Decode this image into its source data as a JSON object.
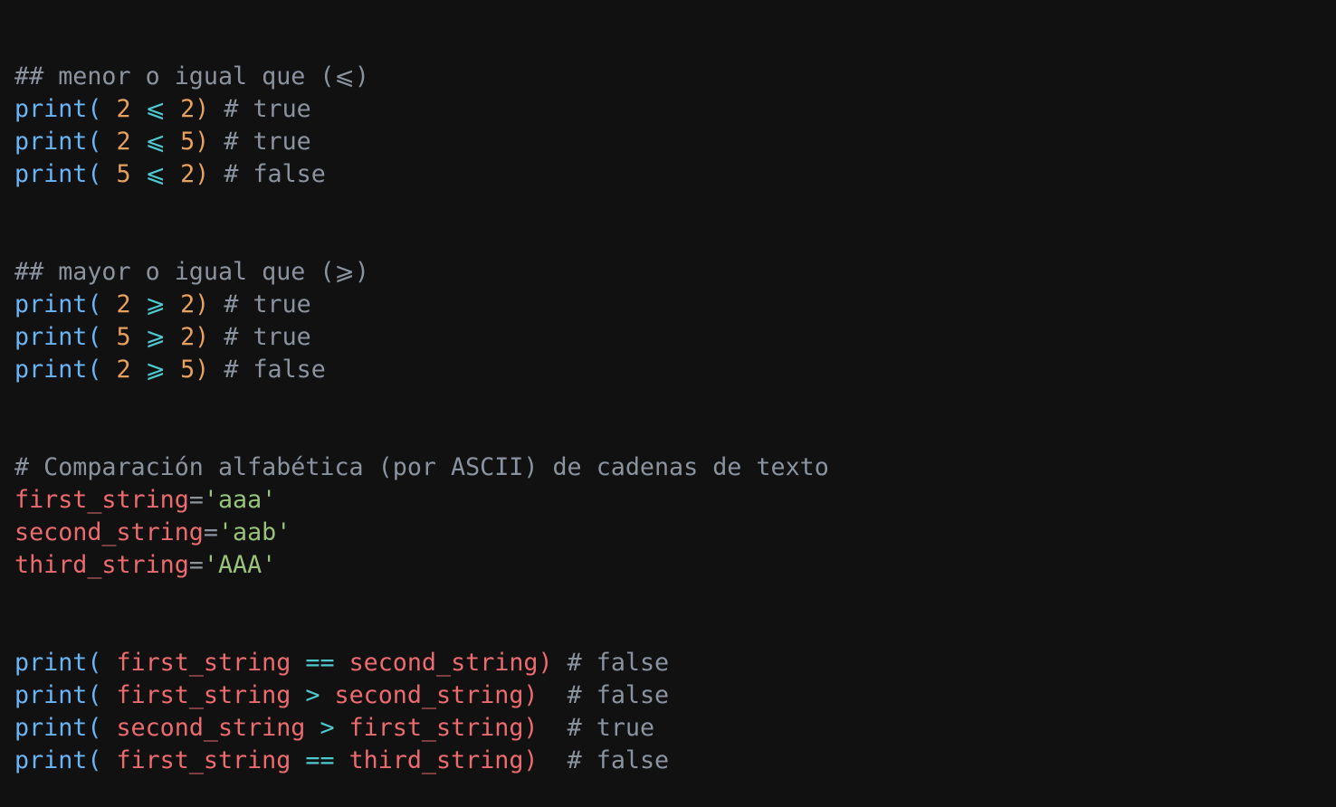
{
  "colors": {
    "background": "#111111",
    "comment": "#8b949e",
    "function": "#69b5f5",
    "paren": "#69b5f5",
    "number": "#e8a15c",
    "operator": "#4ec9cf",
    "variable": "#ec6b6f",
    "string": "#98c379",
    "plain": "#c9d1d9"
  },
  "code": {
    "lines": [
      [
        {
          "t": "## menor o igual que (⩽)",
          "k": "comment"
        }
      ],
      [
        {
          "t": "print",
          "k": "function"
        },
        {
          "t": "( ",
          "k": "paren"
        },
        {
          "t": "2",
          "k": "number"
        },
        {
          "t": " ",
          "k": "plain"
        },
        {
          "t": "⩽",
          "k": "operator"
        },
        {
          "t": " ",
          "k": "plain"
        },
        {
          "t": "2",
          "k": "number"
        },
        {
          "t": ")",
          "k": "number"
        },
        {
          "t": " # true",
          "k": "comment"
        }
      ],
      [
        {
          "t": "print",
          "k": "function"
        },
        {
          "t": "( ",
          "k": "paren"
        },
        {
          "t": "2",
          "k": "number"
        },
        {
          "t": " ",
          "k": "plain"
        },
        {
          "t": "⩽",
          "k": "operator"
        },
        {
          "t": " ",
          "k": "plain"
        },
        {
          "t": "5",
          "k": "number"
        },
        {
          "t": ")",
          "k": "number"
        },
        {
          "t": " # true",
          "k": "comment"
        }
      ],
      [
        {
          "t": "print",
          "k": "function"
        },
        {
          "t": "( ",
          "k": "paren"
        },
        {
          "t": "5",
          "k": "number"
        },
        {
          "t": " ",
          "k": "plain"
        },
        {
          "t": "⩽",
          "k": "operator"
        },
        {
          "t": " ",
          "k": "plain"
        },
        {
          "t": "2",
          "k": "number"
        },
        {
          "t": ")",
          "k": "number"
        },
        {
          "t": " # false",
          "k": "comment"
        }
      ],
      [],
      [],
      [
        {
          "t": "## mayor o igual que (⩾)",
          "k": "comment"
        }
      ],
      [
        {
          "t": "print",
          "k": "function"
        },
        {
          "t": "( ",
          "k": "paren"
        },
        {
          "t": "2",
          "k": "number"
        },
        {
          "t": " ",
          "k": "plain"
        },
        {
          "t": "⩾",
          "k": "operator"
        },
        {
          "t": " ",
          "k": "plain"
        },
        {
          "t": "2",
          "k": "number"
        },
        {
          "t": ")",
          "k": "number"
        },
        {
          "t": " # true",
          "k": "comment"
        }
      ],
      [
        {
          "t": "print",
          "k": "function"
        },
        {
          "t": "( ",
          "k": "paren"
        },
        {
          "t": "5",
          "k": "number"
        },
        {
          "t": " ",
          "k": "plain"
        },
        {
          "t": "⩾",
          "k": "operator"
        },
        {
          "t": " ",
          "k": "plain"
        },
        {
          "t": "2",
          "k": "number"
        },
        {
          "t": ")",
          "k": "number"
        },
        {
          "t": " # true",
          "k": "comment"
        }
      ],
      [
        {
          "t": "print",
          "k": "function"
        },
        {
          "t": "( ",
          "k": "paren"
        },
        {
          "t": "2",
          "k": "number"
        },
        {
          "t": " ",
          "k": "plain"
        },
        {
          "t": "⩾",
          "k": "operator"
        },
        {
          "t": " ",
          "k": "plain"
        },
        {
          "t": "5",
          "k": "number"
        },
        {
          "t": ")",
          "k": "number"
        },
        {
          "t": " # false",
          "k": "comment"
        }
      ],
      [],
      [],
      [
        {
          "t": "# Comparación alfabética (por ASCII) de cadenas de texto",
          "k": "comment"
        }
      ],
      [
        {
          "t": "first_string",
          "k": "variable"
        },
        {
          "t": "=",
          "k": "comment"
        },
        {
          "t": "'aaa'",
          "k": "string"
        }
      ],
      [
        {
          "t": "second_string",
          "k": "variable"
        },
        {
          "t": "=",
          "k": "comment"
        },
        {
          "t": "'aab'",
          "k": "string"
        }
      ],
      [
        {
          "t": "third_string",
          "k": "variable"
        },
        {
          "t": "=",
          "k": "comment"
        },
        {
          "t": "'AAA'",
          "k": "string"
        }
      ],
      [],
      [],
      [
        {
          "t": "print",
          "k": "function"
        },
        {
          "t": "( ",
          "k": "paren"
        },
        {
          "t": "first_string",
          "k": "variable"
        },
        {
          "t": " ",
          "k": "plain"
        },
        {
          "t": "==",
          "k": "operator"
        },
        {
          "t": " ",
          "k": "plain"
        },
        {
          "t": "second_string",
          "k": "variable"
        },
        {
          "t": ")",
          "k": "variable"
        },
        {
          "t": " # false",
          "k": "comment"
        }
      ],
      [
        {
          "t": "print",
          "k": "function"
        },
        {
          "t": "( ",
          "k": "paren"
        },
        {
          "t": "first_string",
          "k": "variable"
        },
        {
          "t": " ",
          "k": "plain"
        },
        {
          "t": ">",
          "k": "operator"
        },
        {
          "t": " ",
          "k": "plain"
        },
        {
          "t": "second_string",
          "k": "variable"
        },
        {
          "t": ")",
          "k": "variable"
        },
        {
          "t": "  # false",
          "k": "comment"
        }
      ],
      [
        {
          "t": "print",
          "k": "function"
        },
        {
          "t": "( ",
          "k": "paren"
        },
        {
          "t": "second_string",
          "k": "variable"
        },
        {
          "t": " ",
          "k": "plain"
        },
        {
          "t": ">",
          "k": "operator"
        },
        {
          "t": " ",
          "k": "plain"
        },
        {
          "t": "first_string",
          "k": "variable"
        },
        {
          "t": ")",
          "k": "variable"
        },
        {
          "t": "  # true",
          "k": "comment"
        }
      ],
      [
        {
          "t": "print",
          "k": "function"
        },
        {
          "t": "( ",
          "k": "paren"
        },
        {
          "t": "first_string",
          "k": "variable"
        },
        {
          "t": " ",
          "k": "plain"
        },
        {
          "t": "==",
          "k": "operator"
        },
        {
          "t": " ",
          "k": "plain"
        },
        {
          "t": "third_string",
          "k": "variable"
        },
        {
          "t": ")",
          "k": "variable"
        },
        {
          "t": "  # false",
          "k": "comment"
        }
      ]
    ]
  }
}
